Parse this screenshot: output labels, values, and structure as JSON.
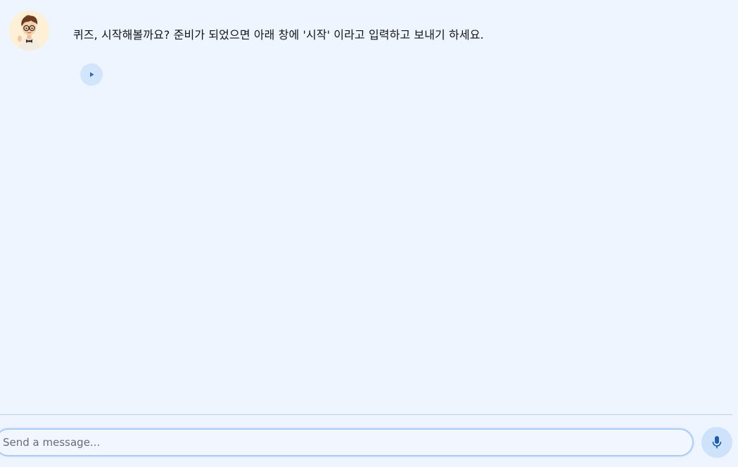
{
  "chat": {
    "messages": [
      {
        "sender": "assistant",
        "avatar_icon": "cartoon-boy-with-glasses-icon",
        "text": "퀴즈, 시작해볼까요? 준비가 되었으면 아래 창에 '시작' 이라고 입력하고 보내기 하세요."
      }
    ]
  },
  "composer": {
    "placeholder": "Send a message...",
    "value": "",
    "mic_icon": "microphone-icon"
  },
  "colors": {
    "background": "#eff5ff",
    "accent": "#2f6fb8",
    "button_bg": "#d3e5fb",
    "input_border": "#a9cdf3"
  }
}
